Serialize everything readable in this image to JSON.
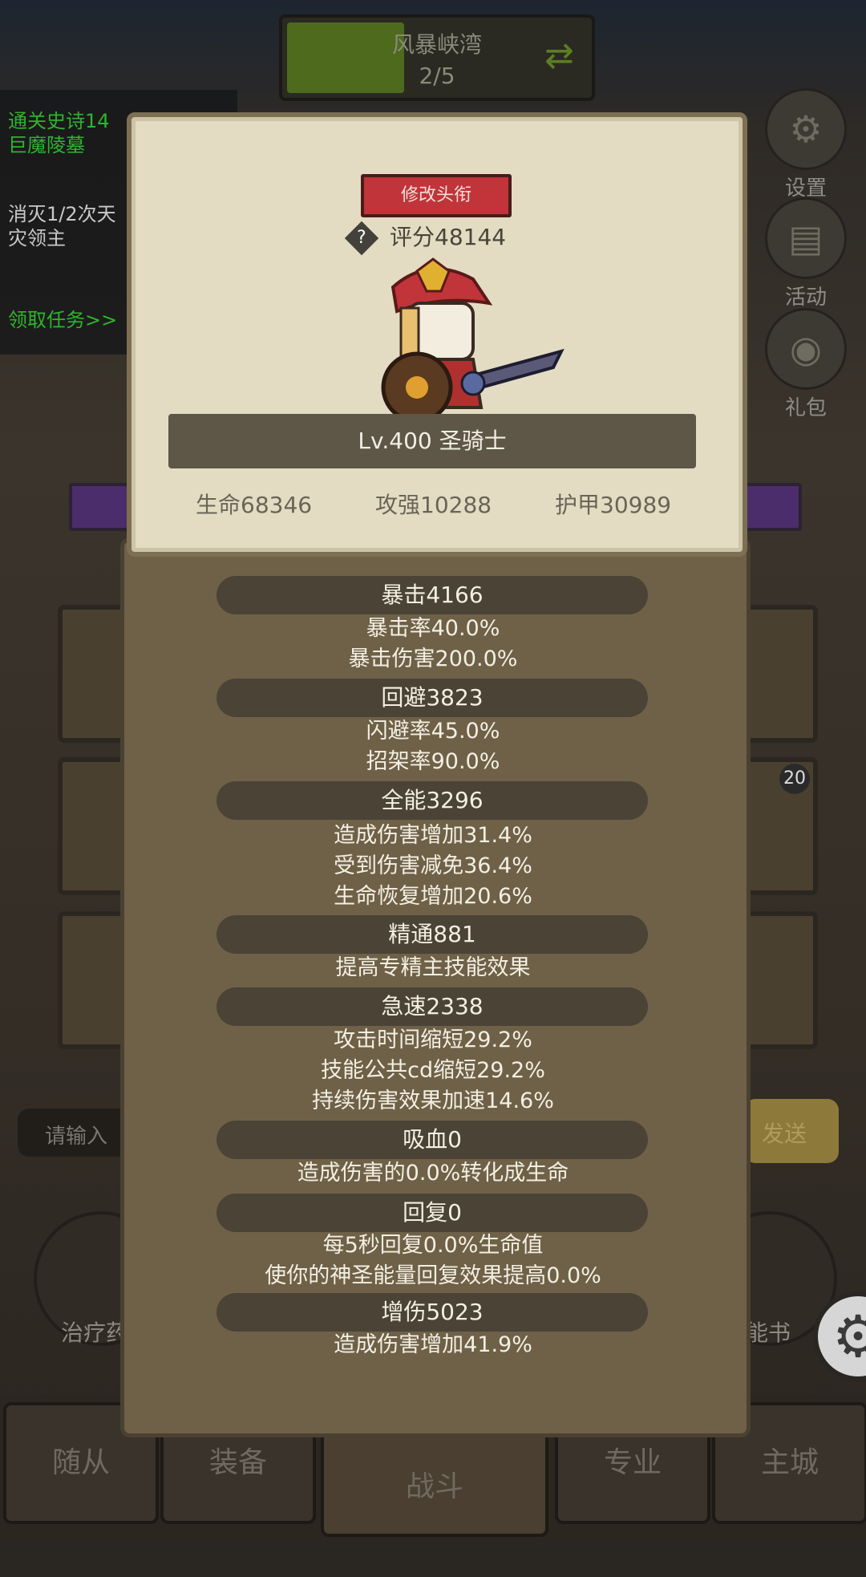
{
  "stage": {
    "name": "风暴峡湾",
    "progress": "2/5",
    "progress_fraction": 0.4
  },
  "quests": [
    {
      "line1": "通关史诗14",
      "line2": "巨魔陵墓",
      "color": "#2db52d"
    },
    {
      "line1": "消灭1/2次天",
      "line2": "灾领主",
      "color": "#c9c9c9"
    },
    {
      "line1": "领取任务>>",
      "line2": "",
      "color": "#2db52d"
    }
  ],
  "side": {
    "settings": "设置",
    "activity": "活动",
    "gift": "礼包"
  },
  "tile_badge": "20",
  "chat": {
    "placeholder": "请输入",
    "send": "发送"
  },
  "background_buttons": {
    "heal": "治疗药",
    "book": "能书"
  },
  "nav": {
    "followers": "随从",
    "equipment": "装备",
    "battle": "战斗",
    "profession": "专业",
    "city": "主城"
  },
  "popup": {
    "title_button": "修改头衔",
    "score": "评分48144",
    "level_class": "Lv.400 圣骑士",
    "hp": "生命68346",
    "attack": "攻强10288",
    "armor": "护甲30989",
    "sections": [
      {
        "title": "暴击4166",
        "lines": [
          "暴击率40.0%",
          "暴击伤害200.0%"
        ]
      },
      {
        "title": "回避3823",
        "lines": [
          "闪避率45.0%",
          "招架率90.0%"
        ]
      },
      {
        "title": "全能3296",
        "lines": [
          "造成伤害增加31.4%",
          "受到伤害减免36.4%",
          "生命恢复增加20.6%"
        ]
      },
      {
        "title": "精通881",
        "lines": [
          "提高专精主技能效果"
        ]
      },
      {
        "title": "急速2338",
        "lines": [
          "攻击时间缩短29.2%",
          "技能公共cd缩短29.2%",
          "持续伤害效果加速14.6%"
        ]
      },
      {
        "title": "吸血0",
        "lines": [
          "造成伤害的0.0%转化成生命"
        ]
      },
      {
        "title": "回复0",
        "lines": [
          "每5秒回复0.0%生命值",
          "使你的神圣能量回复效果提高0.0%"
        ]
      },
      {
        "title": "增伤5023",
        "lines": [
          "造成伤害增加41.9%"
        ]
      }
    ]
  }
}
